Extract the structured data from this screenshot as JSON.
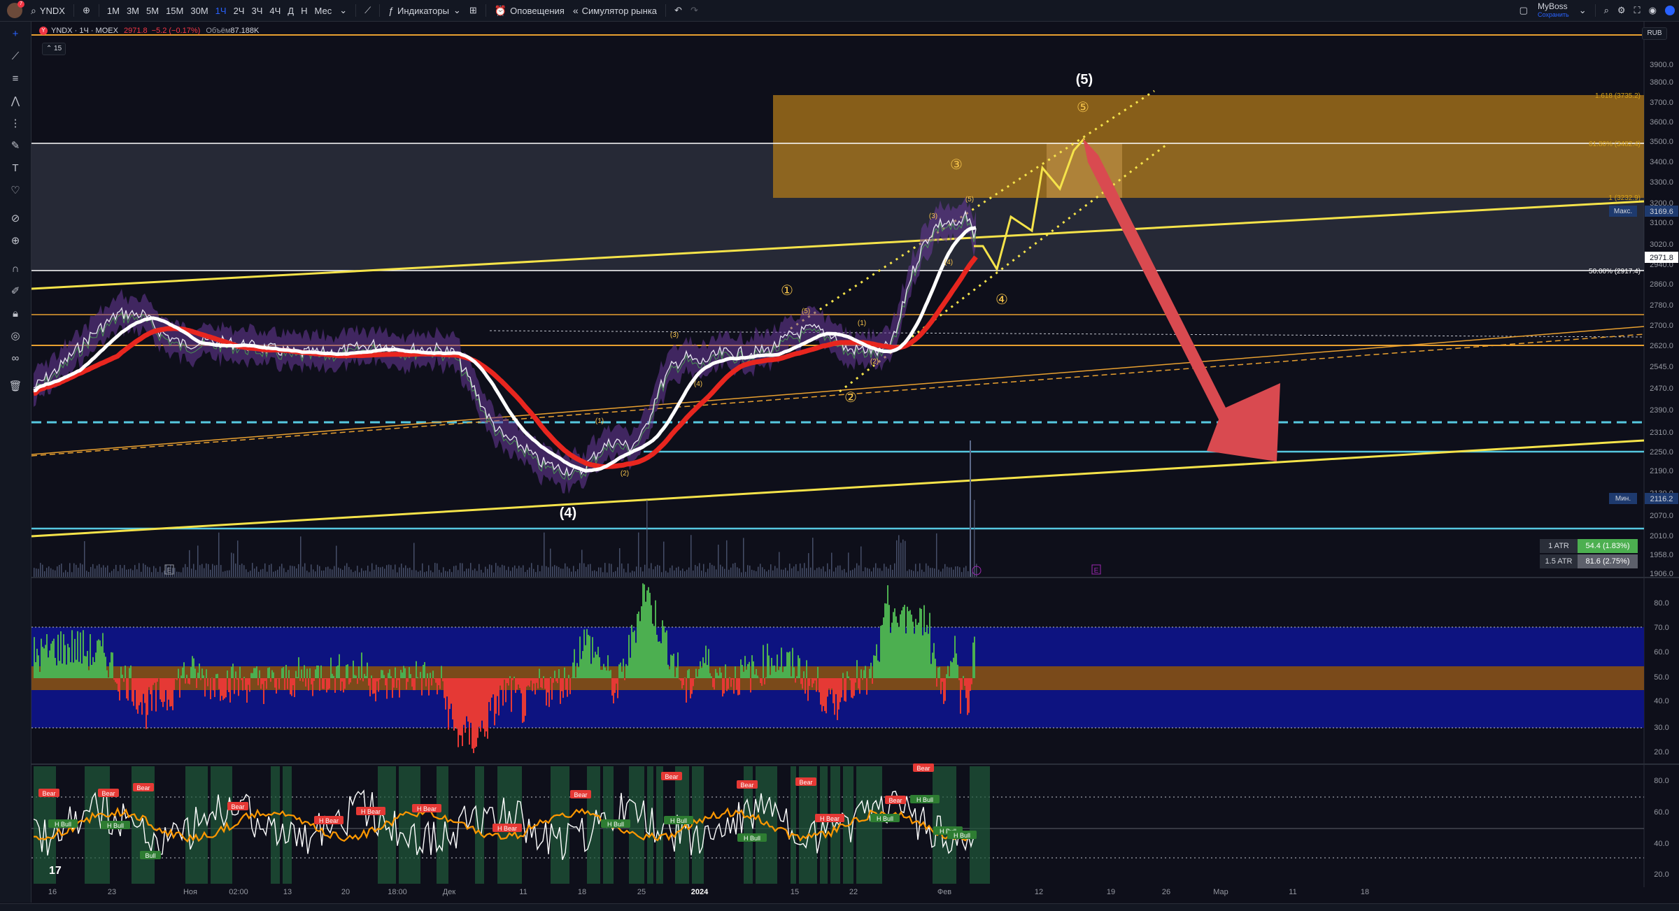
{
  "toolbar": {
    "symbol": "YNDX",
    "notification_count": "7",
    "intervals": [
      "1М",
      "3М",
      "5М",
      "15М",
      "30М",
      "1Ч",
      "2Ч",
      "3Ч",
      "4Ч",
      "Д",
      "Н",
      "Мес"
    ],
    "active_interval": "1Ч",
    "indicators_label": "Индикаторы",
    "alerts_label": "Оповещения",
    "replay_label": "Симулятор рынка",
    "account_name": "MyBoss",
    "account_sub": "Сохранить"
  },
  "legend": {
    "logo_letter": "Y",
    "title": "YNDX · 1Ч · MOEX",
    "price": "2971.8",
    "change": "−5.2 (−0.17%)",
    "volume_label": "Объём",
    "volume_value": "87.188K",
    "collapse_label": "15"
  },
  "currency": "RUB",
  "price_axis": {
    "ticks": [
      "3900.0",
      "3800.0",
      "3700.0",
      "3600.0",
      "3500.0",
      "3400.0",
      "3300.0",
      "3200.0",
      "3100.0",
      "3020.0",
      "2940.0",
      "2860.0",
      "2780.0",
      "2700.0",
      "2620.0",
      "2545.0",
      "2470.0",
      "2390.0",
      "2310.0",
      "2250.0",
      "2190.0",
      "2130.0",
      "2070.0",
      "2010.0",
      "1958.0",
      "1906.0"
    ],
    "max_label": "Макс.",
    "max_value": "3169.6",
    "current_value": "2971.8",
    "min_label": "Мин.",
    "min_value": "2116.2"
  },
  "fib_levels": [
    {
      "label": "1.618 (3735.2)",
      "color": "#d4a017"
    },
    {
      "label": "61.80% (3482.4)",
      "color": "#d4a017"
    },
    {
      "label": "1 (3232.9)",
      "color": "#d4a017"
    },
    {
      "label": "50.00% (2917.4)",
      "color": "#ffffff"
    }
  ],
  "wave_labels": {
    "top_main": "(5)",
    "bottom_main": "(4)",
    "circled": [
      "①",
      "②",
      "③",
      "④",
      "⑤"
    ],
    "minor": [
      "(3)",
      "(4)",
      "(5)",
      "(1)",
      "(2)",
      "(3)",
      "(4)",
      "(5)",
      "(2)",
      "(1)"
    ]
  },
  "atr": [
    {
      "label": "1 ATR",
      "value": "54.4 (1.83%)",
      "color": "#4caf50"
    },
    {
      "label": "1.5 ATR",
      "value": "81.6 (2.75%)",
      "color": "#5d606b"
    }
  ],
  "osc1_axis": [
    "80.0",
    "70.0",
    "60.0",
    "50.0",
    "40.0",
    "30.0",
    "20.0"
  ],
  "osc2_axis": [
    "80.0",
    "60.0",
    "40.0",
    "20.0"
  ],
  "signal_labels": {
    "bear": "Bear",
    "hbear": "H Bear",
    "bull": "Bull",
    "hbull": "H Bull"
  },
  "time_axis": [
    "16",
    "23",
    "Ноя",
    "02:00",
    "13",
    "20",
    "18:00",
    "Дек",
    "11",
    "18",
    "25",
    "2024",
    "15",
    "22",
    "Фев",
    "12",
    "19",
    "26",
    "Мар",
    "11",
    "18"
  ],
  "colors": {
    "background": "#0e0f1a",
    "fib_zone": "#b07a1a",
    "trend_yellow": "#f5e34a",
    "ema_red": "#e8261f",
    "ema_white": "#ffffff",
    "arrow_red": "#d94a50",
    "cyan": "#56c8e0",
    "osc_green": "#4caf50",
    "osc_red": "#e53935"
  },
  "icons": [
    "cross-icon",
    "line-icon",
    "fib-icon",
    "pattern-icon",
    "ruler-icon",
    "brush-icon",
    "text-icon",
    "heart-icon",
    "measure-icon",
    "zoom-icon",
    "magnet-icon",
    "lock-icon",
    "eye-icon",
    "link-icon",
    "trash-icon"
  ]
}
